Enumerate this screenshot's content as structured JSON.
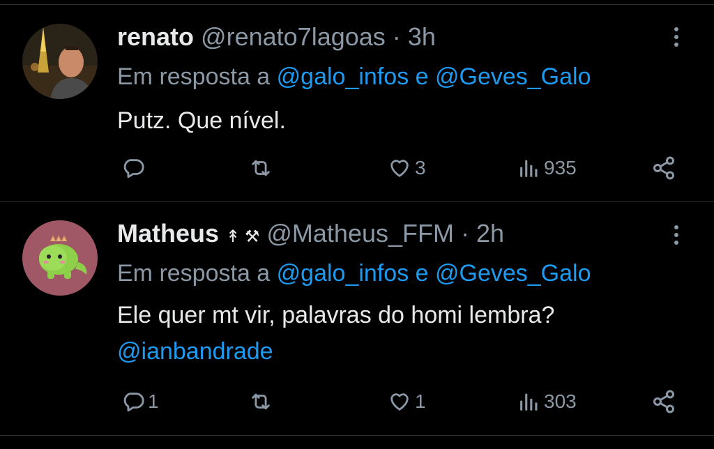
{
  "tweets": [
    {
      "name": "renato",
      "handle": "@renato7lagoas",
      "separator": "·",
      "time": "3h",
      "reply_prefix": "Em resposta a",
      "reply_mentions": "@galo_infos e @Geves_Galo",
      "text": "Putz. Que nível.",
      "text_mention": "",
      "avatar_icon": "eiffel-tower-photo-avatar",
      "reply_count": "",
      "retweet_count": "",
      "like_count": "3",
      "view_count": "935"
    },
    {
      "name": "Matheus",
      "badges": "↟ ⚒",
      "handle": "@Matheus_FFM",
      "separator": "·",
      "time": "2h",
      "reply_prefix": "Em resposta a",
      "reply_mentions": "@galo_infos e @Geves_Galo",
      "text": "Ele quer mt vir, palavras do homi lembra?",
      "text_mention": "@ianbandrade",
      "avatar_icon": "green-dinosaur-avatar",
      "reply_count": "1",
      "retweet_count": "",
      "like_count": "1",
      "view_count": "303"
    }
  ],
  "colors": {
    "background": "#000000",
    "primary_text": "#e7e9ea",
    "secondary_text": "#8b98a5",
    "link": "#1d9bf0",
    "divider": "#2f3336"
  }
}
